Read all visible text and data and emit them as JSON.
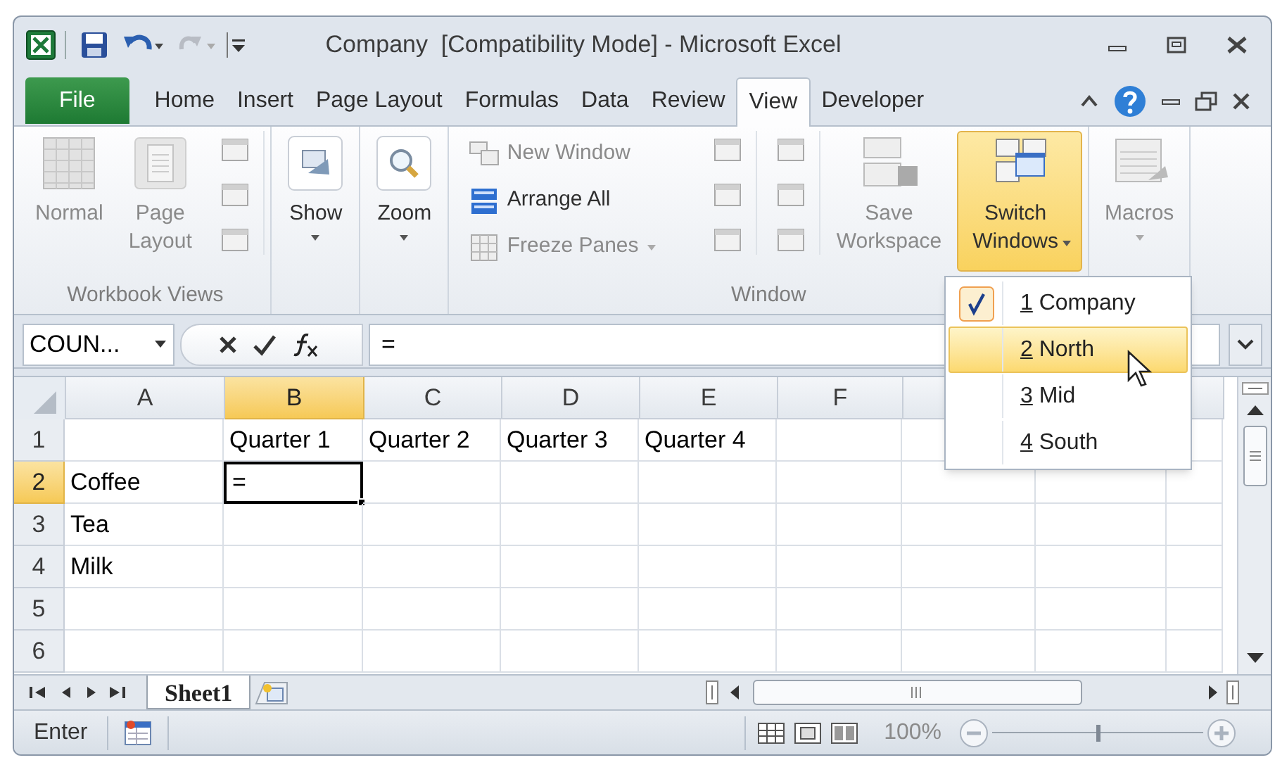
{
  "window": {
    "title": "Company  [Compatibility Mode] - Microsoft Excel"
  },
  "ribbon_tabs": [
    {
      "label": "File",
      "kind": "file",
      "selected": false
    },
    {
      "label": "Home",
      "kind": "tab",
      "selected": false
    },
    {
      "label": "Insert",
      "kind": "tab",
      "selected": false
    },
    {
      "label": "Page Layout",
      "kind": "tab",
      "selected": false
    },
    {
      "label": "Formulas",
      "kind": "tab",
      "selected": false
    },
    {
      "label": "Data",
      "kind": "tab",
      "selected": false
    },
    {
      "label": "Review",
      "kind": "tab",
      "selected": false
    },
    {
      "label": "View",
      "kind": "tab",
      "selected": true
    },
    {
      "label": "Developer",
      "kind": "tab",
      "selected": false
    }
  ],
  "ribbon_groups": [
    {
      "label": "Workbook Views",
      "items": [
        {
          "kind": "large",
          "label": "Normal",
          "disabled": true,
          "caret": false,
          "pressed": false
        },
        {
          "kind": "large",
          "label": "Page Layout",
          "disabled": true,
          "caret": false,
          "pressed": false
        },
        {
          "kind": "icons"
        }
      ]
    },
    {
      "items": [
        {
          "kind": "large",
          "label": "Show",
          "disabled": false,
          "caret": true,
          "pressed": false
        }
      ]
    },
    {
      "items": [
        {
          "kind": "large",
          "label": "Zoom",
          "disabled": false,
          "caret": true,
          "pressed": false
        }
      ]
    },
    {
      "label": "Window",
      "items": [
        {
          "kind": "small",
          "buttons": [
            {
              "label": "New Window",
              "disabled": true,
              "caret": false
            },
            {
              "label": "Arrange All",
              "disabled": false,
              "caret": false
            },
            {
              "label": "Freeze Panes",
              "disabled": true,
              "caret": true
            }
          ]
        },
        {
          "kind": "icons"
        },
        {
          "kind": "icons"
        },
        {
          "kind": "large",
          "label": "Save Workspace",
          "disabled": true,
          "caret": false,
          "pressed": false
        },
        {
          "kind": "large",
          "label": "Switch Windows",
          "disabled": false,
          "caret": true,
          "pressed": true
        }
      ]
    },
    {
      "items": [
        {
          "kind": "large",
          "label": "Macros",
          "disabled": true,
          "caret": true,
          "pressed": false
        }
      ]
    }
  ],
  "switch_windows_menu": [
    {
      "key": "1",
      "label": "Company",
      "checked": true,
      "selected": false
    },
    {
      "key": "2",
      "label": "North",
      "checked": false,
      "selected": true
    },
    {
      "key": "3",
      "label": "Mid",
      "checked": false,
      "selected": false
    },
    {
      "key": "4",
      "label": "South",
      "checked": false,
      "selected": false
    }
  ],
  "formula_bar": {
    "name_box": "COUN...",
    "formula": "="
  },
  "sheet": {
    "columns": [
      {
        "label": "A",
        "selected": false
      },
      {
        "label": "B",
        "selected": true
      },
      {
        "label": "C",
        "selected": false
      },
      {
        "label": "D",
        "selected": false
      },
      {
        "label": "E",
        "selected": false
      },
      {
        "label": "F",
        "selected": false
      }
    ],
    "rows": [
      {
        "header": "1",
        "selected": false,
        "cells": [
          null,
          "Quarter 1",
          "Quarter 2",
          "Quarter 3",
          "Quarter 4",
          null
        ]
      },
      {
        "header": "2",
        "selected": true,
        "cells": [
          "Coffee",
          "=",
          null,
          null,
          null,
          null
        ]
      },
      {
        "header": "3",
        "selected": false,
        "cells": [
          "Tea",
          null,
          null,
          null,
          null,
          null
        ]
      },
      {
        "header": "4",
        "selected": false,
        "cells": [
          "Milk",
          null,
          null,
          null,
          null,
          null
        ]
      },
      {
        "header": "5",
        "selected": false,
        "cells": [
          null,
          null,
          null,
          null,
          null,
          null
        ]
      },
      {
        "header": "6",
        "selected": false,
        "cells": [
          null,
          null,
          null,
          null,
          null,
          null
        ]
      }
    ]
  },
  "sheet_tabs": [
    {
      "label": "Sheet1",
      "selected": true
    }
  ],
  "status_bar": {
    "mode": "Enter",
    "zoom": "100%",
    "zoom_slider": {
      "level": 0.5
    }
  }
}
